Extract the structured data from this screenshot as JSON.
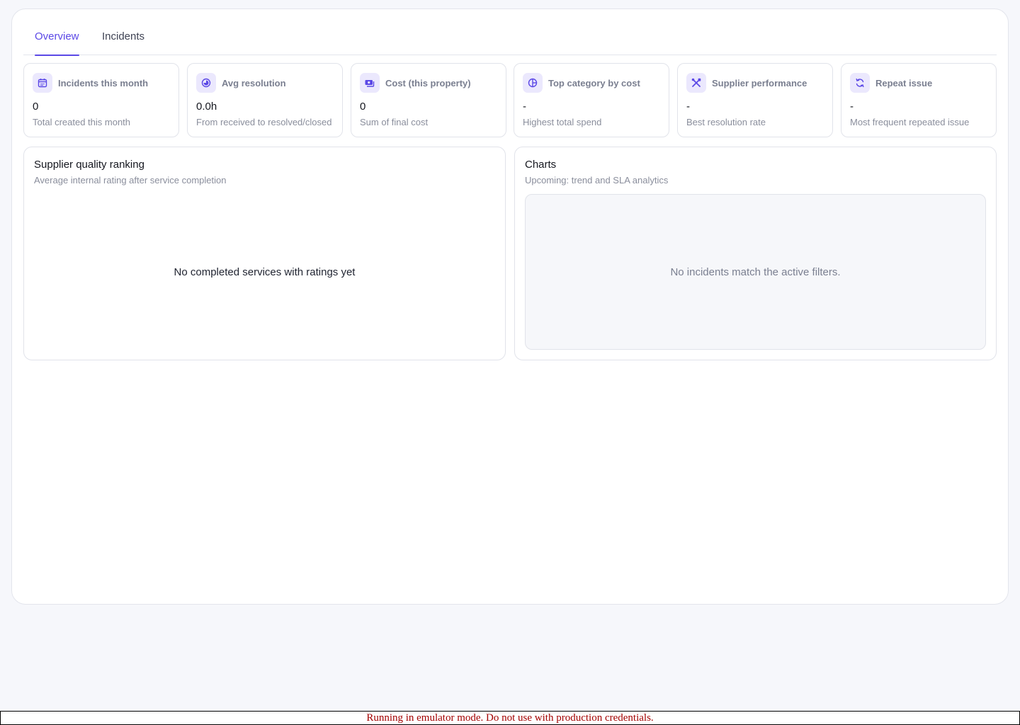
{
  "tabs": [
    {
      "label": "Overview",
      "active": true
    },
    {
      "label": "Incidents",
      "active": false
    }
  ],
  "kpis": [
    {
      "icon": "calendar-icon",
      "label": "Incidents this month",
      "value": "0",
      "sub": "Total created this month"
    },
    {
      "icon": "clock-icon",
      "label": "Avg resolution",
      "value": "0.0h",
      "sub": "From received to resolved/closed"
    },
    {
      "icon": "money-icon",
      "label": "Cost (this property)",
      "value": "0",
      "sub": "Sum of final cost"
    },
    {
      "icon": "pie-chart-icon",
      "label": "Top category by cost",
      "value": "-",
      "sub": "Highest total spend"
    },
    {
      "icon": "tools-icon",
      "label": "Supplier performance",
      "value": "-",
      "sub": "Best resolution rate"
    },
    {
      "icon": "refresh-icon",
      "label": "Repeat issue",
      "value": "-",
      "sub": "Most frequent repeated issue"
    }
  ],
  "supplier_panel": {
    "title": "Supplier quality ranking",
    "subtitle": "Average internal rating after service completion",
    "empty": "No completed services with ratings yet"
  },
  "charts_panel": {
    "title": "Charts",
    "subtitle": "Upcoming: trend and SLA analytics",
    "empty": "No incidents match the active filters."
  },
  "emulator_notice": "Running in emulator mode. Do not use with production credentials.",
  "colors": {
    "accent": "#5b48e6",
    "icon_bg": "#ebe8fd",
    "notice": "#a30000"
  }
}
